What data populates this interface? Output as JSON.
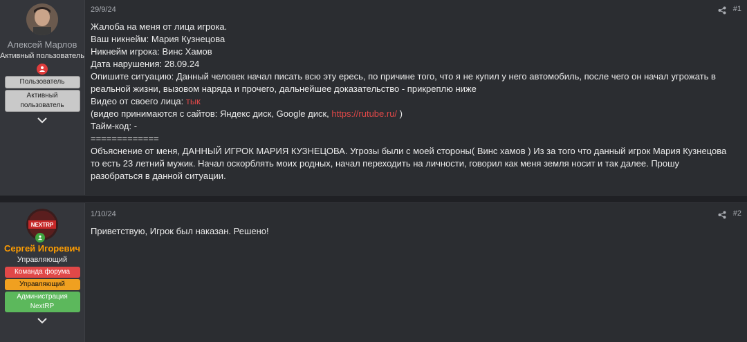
{
  "posts": [
    {
      "date": "29/9/24",
      "number": "#1",
      "author": {
        "name": "Алексей Марлов",
        "title": "Активный пользователь",
        "badges": [
          "Пользователь",
          "Активный пользователь"
        ]
      },
      "lines": {
        "l1": "Жалоба на меня от лица игрока.",
        "l2": "Ваш никнейм: Мария Кузнецова",
        "l3": "Никнейм игрока: Винс Хамов",
        "l4": "Дата нарушения: 28.09.24",
        "l5": "Опишите ситуацию: Данный человек начал писать всю эту ересь, по причине того, что я не купил у него автомобиль, после чего он начал угрожать в реальной жизни, вызовом наряда и прочего, дальнейшее доказательство - прикреплю ниже",
        "l6_prefix": "Видео от своего лица: ",
        "l6_link": "тык",
        "l7_prefix": "(видео принимаются с сайтов: Яндекс диск, Google диск, ",
        "l7_link": "https://rutube.ru/",
        "l7_suffix": " )",
        "l8": "Тайм-код: -",
        "l9": "=============",
        "l10": "Объяснение от меня, ДАННЫЙ ИГРОК МАРИЯ КУЗНЕЦОВА. Угрозы были с моей стороны( Винс хамов ) Из за того что данный игрок Мария Кузнецова то есть 23 летний мужик. Начал оскорблять моих родных, начал переходить на личности, говорил как меня земля носит и так далее. Прошу разобраться в данной ситуации."
      }
    },
    {
      "date": "1/10/24",
      "number": "#2",
      "author": {
        "name": "Сергей Игоревич",
        "title": "Управляющий",
        "avatar_text": "NEXTRP",
        "badges": [
          "Команда форума",
          "Управляющий",
          "Администрация NextRP"
        ]
      },
      "lines": {
        "l1": "Приветствую, Игрок был наказан. Решено!"
      }
    }
  ],
  "colors": {
    "link": "#e04848",
    "staff_name": "#ff9d00",
    "badge_team": "#e04848",
    "badge_manager": "#f0a020",
    "badge_admin": "#5cb85c"
  },
  "icons": [
    "user-status-icon",
    "share-icon",
    "chevron-down-icon",
    "avatar"
  ]
}
